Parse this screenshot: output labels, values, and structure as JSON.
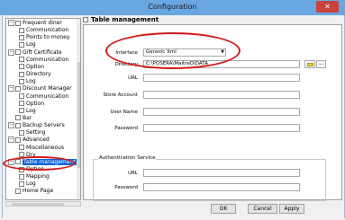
{
  "window": {
    "title": "Configuration",
    "close_glyph": "✕"
  },
  "tree": {
    "items": [
      {
        "label": "Frequent diner",
        "level": 0,
        "expander": "⊟"
      },
      {
        "label": "Communication",
        "level": 1
      },
      {
        "label": "Points to money",
        "level": 1
      },
      {
        "label": "Log",
        "level": 1
      },
      {
        "label": "Gift Certificate",
        "level": 0,
        "expander": "⊟"
      },
      {
        "label": "Communication",
        "level": 1
      },
      {
        "label": "Option",
        "level": 1
      },
      {
        "label": "Directory",
        "level": 1
      },
      {
        "label": "Log",
        "level": 1
      },
      {
        "label": "Discount Manager",
        "level": 0,
        "expander": "⊟"
      },
      {
        "label": "Communication",
        "level": 1
      },
      {
        "label": "Option",
        "level": 1
      },
      {
        "label": "Log",
        "level": 1
      },
      {
        "label": "Bar",
        "level": 0
      },
      {
        "label": "Backup Servers",
        "level": 0,
        "expander": "⊟"
      },
      {
        "label": "Setting",
        "level": 1
      },
      {
        "label": "Advanced",
        "level": 0,
        "expander": "⊟"
      },
      {
        "label": "Miscellaneous",
        "level": 1
      },
      {
        "label": "Dry",
        "level": 1
      },
      {
        "label": "Table management",
        "level": 0,
        "expander": "⊟",
        "selected": true
      },
      {
        "label": "Option",
        "level": 1
      },
      {
        "label": "Mapping",
        "level": 1
      },
      {
        "label": "Log",
        "level": 1
      },
      {
        "label": "Home Page",
        "level": 0
      }
    ]
  },
  "panel": {
    "header": "Table management",
    "interface_label": "Interface",
    "interface_value": "Generic Xml",
    "directory_label": "Directory",
    "directory_value": "C:\\POSERA\\MaitreD\\DATA",
    "dots_label": "...",
    "url_label": "URL",
    "url_value": "",
    "store_account_label": "Store Account",
    "store_account_value": "",
    "user_name_label": "User Name",
    "user_name_value": "",
    "password_label": "Password",
    "password_value": "",
    "auth_group_title": "Authentication Service",
    "auth_url_label": "URL",
    "auth_url_value": "",
    "auth_password_label": "Password",
    "auth_password_value": ""
  },
  "buttons": {
    "ok": "OK",
    "cancel": "Cancel",
    "apply": "Apply"
  },
  "colors": {
    "annotation": "#d11a1a",
    "selection": "#0a64d8",
    "titlebar": "#6aa6e2",
    "close": "#c7443d"
  },
  "icons": [
    "close-icon",
    "folder-icon",
    "page-icon",
    "chevron-down-icon",
    "tree-expander-icon"
  ]
}
